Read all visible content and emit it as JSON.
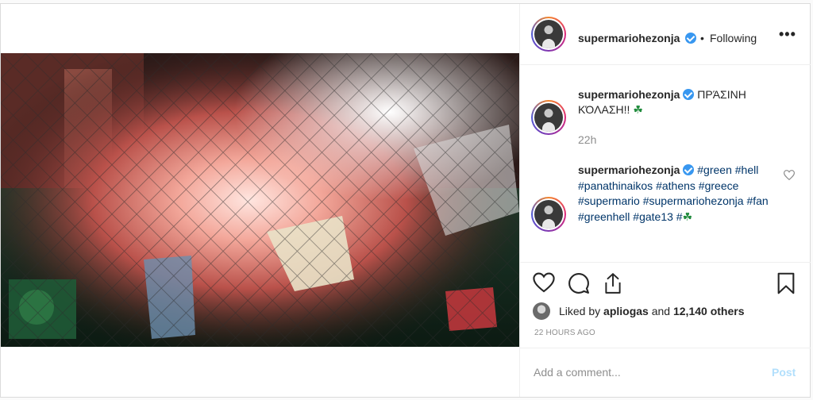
{
  "header": {
    "username": "supermariohezonja",
    "separator": "•",
    "follow_status": "Following",
    "more_icon": "more-horizontal-icon"
  },
  "caption": {
    "username": "supermariohezonja",
    "text": "ΠΡΆΣΙΝΗ ΚΌΛΑΣΗ!!",
    "emoji": "☘",
    "time": "22h"
  },
  "comment": {
    "username": "supermariohezonja",
    "hashtags": [
      "#green",
      "#hell",
      "#panathinaikos",
      "#athens",
      "#greece",
      "#supermario",
      "#supermariohezonja",
      "#fan",
      "#greenhell",
      "#gate13",
      "#"
    ],
    "emoji": "☘"
  },
  "actions": {
    "like_icon": "heart-icon",
    "comment_icon": "comment-icon",
    "share_icon": "share-icon",
    "save_icon": "bookmark-icon"
  },
  "likes": {
    "prefix": "Liked by",
    "user": "apliogas",
    "conj": "and",
    "count_text": "12,140 others"
  },
  "timestamp": "22 HOURS AGO",
  "add_comment": {
    "placeholder": "Add a comment...",
    "post_label": "Post"
  },
  "colors": {
    "verified": "#3897f0",
    "link": "#003569",
    "muted": "#8e8e8e",
    "post_disabled": "#b2dffc"
  }
}
